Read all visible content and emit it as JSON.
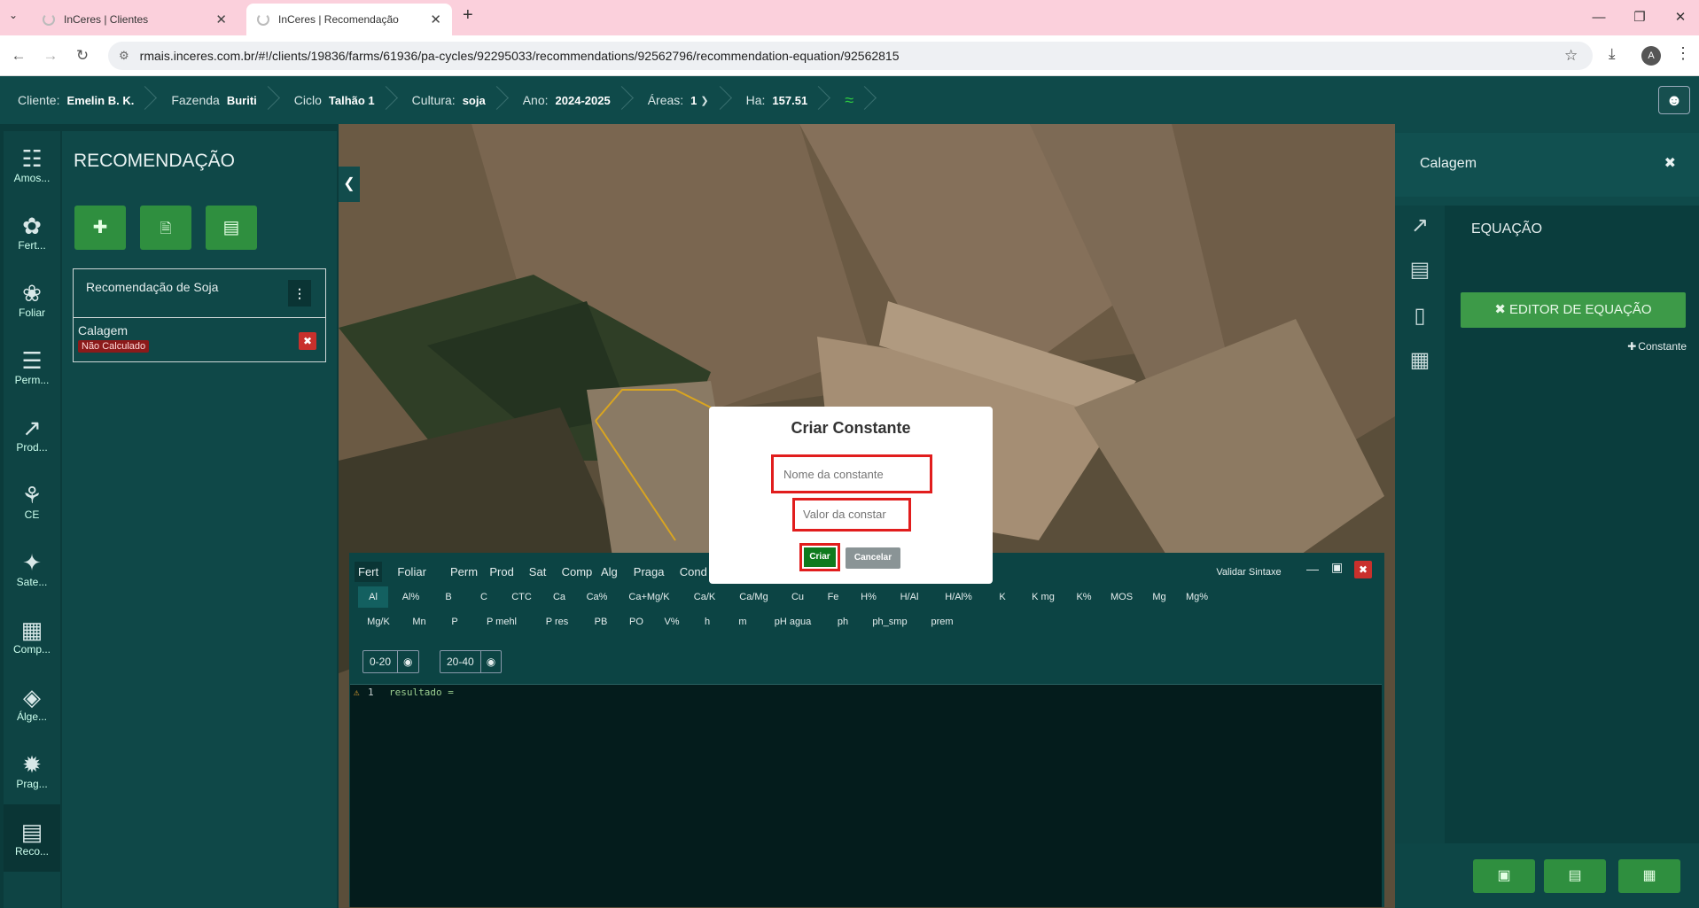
{
  "browser": {
    "tabs": [
      {
        "title": "InCeres | Clientes"
      },
      {
        "title": "InCeres | Recomendação"
      }
    ],
    "url": "rmais.inceres.com.br/#!/clients/19836/farms/61936/pa-cycles/92295033/recommendations/92562796/recommendation-equation/92562815",
    "profile_initial": "A"
  },
  "header": {
    "cliente_label": "Cliente:",
    "cliente_value": "Emelin B. K.",
    "fazenda_label": "Fazenda",
    "fazenda_value": "Buriti",
    "ciclo_label": "Ciclo",
    "ciclo_value": "Talhão 1",
    "cultura_label": "Cultura:",
    "cultura_value": "soja",
    "ano_label": "Ano:",
    "ano_value": "2024-2025",
    "areas_label": "Áreas:",
    "areas_value": "1",
    "ha_label": "Ha:",
    "ha_value": "157.51"
  },
  "rail": [
    {
      "label": "Amos...",
      "icon": "sample-icon"
    },
    {
      "label": "Fert...",
      "icon": "fertility-icon"
    },
    {
      "label": "Foliar",
      "icon": "leaf-icon"
    },
    {
      "label": "Perm...",
      "icon": "perm-icon"
    },
    {
      "label": "Prod...",
      "icon": "chart-icon"
    },
    {
      "label": "CE",
      "icon": "plant-icon"
    },
    {
      "label": "Sate...",
      "icon": "satellite-icon"
    },
    {
      "label": "Comp...",
      "icon": "compaction-icon"
    },
    {
      "label": "Álge...",
      "icon": "layers-icon"
    },
    {
      "label": "Prag...",
      "icon": "bug-icon"
    },
    {
      "label": "Reco...",
      "icon": "recommendation-icon"
    }
  ],
  "recommendation": {
    "title": "RECOMENDAÇÃO",
    "card_title": "Recomendação de Soja",
    "item_name": "Calagem",
    "item_status": "Não Calculado"
  },
  "editor": {
    "tabs": [
      "Fert",
      "Foliar",
      "Perm",
      "Prod",
      "Sat",
      "Comp",
      "Alg",
      "Praga",
      "Cond Ele"
    ],
    "validate_label": "Validar Sintaxe",
    "vars_row1": [
      "Al",
      "Al%",
      "B",
      "C",
      "CTC",
      "Ca",
      "Ca%",
      "Ca+Mg/K",
      "Ca/K",
      "Ca/Mg",
      "Cu",
      "Fe",
      "H%",
      "H/Al",
      "H/Al%",
      "K",
      "K mg",
      "K%",
      "MOS",
      "Mg",
      "Mg%"
    ],
    "vars_row2": [
      "Mg/K",
      "Mn",
      "P",
      "P mehl",
      "P res",
      "PB",
      "PO",
      "V%",
      "h",
      "m",
      "pH agua",
      "ph",
      "ph_smp",
      "prem"
    ],
    "depths": [
      "0-20",
      "20-40"
    ],
    "line_number": "1",
    "code": "resultado ="
  },
  "right_panel": {
    "title": "Calagem",
    "section": "EQUAÇÃO",
    "editor_button": "EDITOR DE EQUAÇÃO",
    "constant_button": "Constante"
  },
  "modal": {
    "title": "Criar Constante",
    "name_placeholder": "Nome da constante",
    "value_placeholder": "Valor da constar",
    "create_label": "Criar",
    "cancel_label": "Cancelar"
  },
  "colors": {
    "app_dark": "#0f4a4a",
    "button_green": "#2f8f3f",
    "danger_red": "#c9302c",
    "highlight_red": "#e11d1d"
  }
}
